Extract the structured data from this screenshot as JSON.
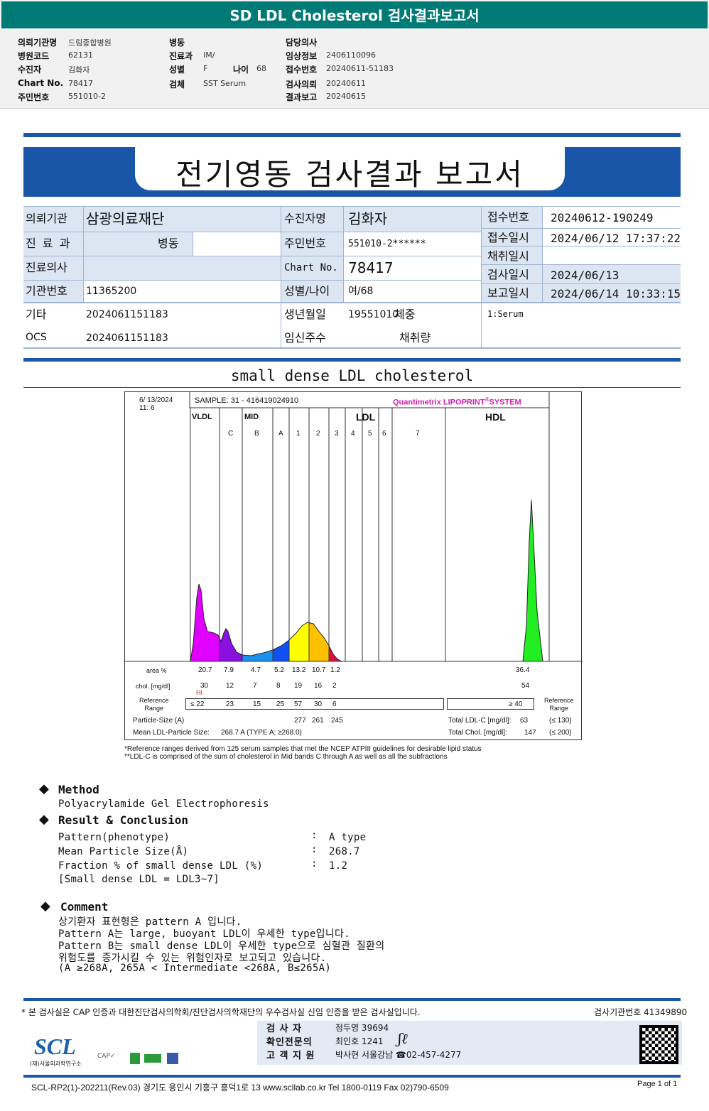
{
  "title": "SD LDL Cholesterol 검사결과보고서",
  "header": {
    "col1": [
      {
        "label": "의뢰기관명",
        "value": "드림종합병원"
      },
      {
        "label": "병원코드",
        "value": "62131"
      },
      {
        "label": "수진자",
        "value": "김화자"
      },
      {
        "label": "Chart No.",
        "value": "78417"
      },
      {
        "label": "주민번호",
        "value": "551010-2"
      }
    ],
    "col2": [
      {
        "label": "병동",
        "value": ""
      },
      {
        "label": "진료과",
        "value": "IM/"
      },
      {
        "label": "성별",
        "value": "F"
      },
      {
        "label": "검체",
        "value": "SST Serum"
      }
    ],
    "age_label": "나이",
    "age_value": "68",
    "col3": [
      {
        "label": "담당의사",
        "value": ""
      },
      {
        "label": "임상정보",
        "value": "2406110096"
      },
      {
        "label": "접수번호",
        "value": "20240611-51183"
      },
      {
        "label": "검사의뢰",
        "value": "20240611"
      },
      {
        "label": "결과보고",
        "value": "20240615"
      }
    ]
  },
  "report_title": "전기영동 검사결과 보고서",
  "info": {
    "inst_label": "의뢰기관",
    "inst": "삼광의료재단",
    "dept_label": "진 료 과",
    "ward_label": "병동",
    "doctor_label": "진료의사",
    "instno_label": "기관번호",
    "instno": "11365200",
    "etc_label": "기타",
    "etc": "2024061151183",
    "ocs_label": "OCS",
    "ocs": "2024061151183",
    "name_label": "수진자명",
    "name": "김화자",
    "ssn_label": "주민번호",
    "ssn": "551010-2******",
    "chart_label": "Chart No.",
    "chart": "78417",
    "sexage_label": "성별/나이",
    "sexage": "여/68",
    "dob_label": "생년월일",
    "dob": "19551010",
    "weight_label": "체중",
    "preg_label": "임신주수",
    "vol_label": "채취량",
    "rcpt_label": "접수번호",
    "rcpt": "20240612-190249",
    "rcpt_time_label": "접수일시",
    "rcpt_time": "2024/06/12 17:37:22",
    "collect_label": "채취일시",
    "collect": "",
    "test_label": "검사일시",
    "test": "2024/06/13",
    "report_label": "보고일시",
    "report": "2024/06/14 10:33:15",
    "specimen": "1:Serum"
  },
  "section_title": "small dense LDL cholesterol",
  "lipoprint": {
    "date": "6/ 13/2024",
    "time": "11:  6",
    "sample": "SAMPLE:    31 - 416419024910",
    "brand": "Quantimetrix LIPOPRINT",
    "brand2": "SYSTEM",
    "groups": [
      "VLDL",
      "MID",
      "LDL",
      "HDL"
    ],
    "bands": [
      "C",
      "B",
      "A",
      "1",
      "2",
      "3",
      "4",
      "5",
      "6",
      "7"
    ],
    "colors": {
      "vldl": "#e000ff",
      "midc": "#8a10e0",
      "midb": "#1a90f0",
      "mida": "#1050f0",
      "ldl1": "#ffff00",
      "ldl2": "#ffc000",
      "ldl3": "#e0103a",
      "hdl": "#22ee22"
    },
    "row_labels": {
      "area": "area %",
      "chol": "chol. [mg/dl]",
      "ref": "Reference\nRange",
      "psize": "Particle-Size (A)",
      "mean": "Mean LDL-Particle Size:"
    },
    "area": [
      "20.7",
      "7.9",
      "4.7",
      "5.2",
      "13.2",
      "10.7",
      "1.2"
    ],
    "area_hdl": "36.4",
    "chol": [
      "30",
      "12",
      "7",
      "8",
      "19",
      "16",
      "2"
    ],
    "chol_hdl": "54",
    "hi_flag": "HI",
    "ref": [
      "≤ 22",
      "23",
      "15",
      "25",
      "57",
      "30",
      "6"
    ],
    "ref_hdl": "≥  40",
    "ref_right": "Reference\nRange",
    "psize": [
      "277",
      "261",
      "245"
    ],
    "mean_value": "268.7  A    (TYPE A; ≥268.0)",
    "total_ldl_label": "Total LDL-C  [mg/dl]:",
    "total_ldl": "63",
    "total_ldl_ref": "(≤ 130)",
    "total_chol_label": "Total Chol.  [mg/dl]:",
    "total_chol": "147",
    "total_chol_ref": "(≤ 200)",
    "note1": "*Reference ranges derived from 125 serum samples that met the NCEP ATPIII guidelines for desirable lipid status",
    "note2": "**LDL-C is comprised of the sum of cholesterol in Mid bands C through A as well as all the subfractions"
  },
  "method": {
    "title": "Method",
    "text": "Polyacrylamide Gel Electrophoresis"
  },
  "result": {
    "title": "Result & Conclusion",
    "rows": [
      {
        "label": "Pattern(phenotype)",
        "value": "A type"
      },
      {
        "label": "Mean Particle Size(Å)",
        "value": "268.7"
      },
      {
        "label": "Fraction % of small dense LDL (%)",
        "value": "1.2"
      }
    ],
    "note": "[Small dense LDL = LDL3~7]"
  },
  "comment": {
    "title": "Comment",
    "lines": [
      "상기환자 표현형은 pattern A 입니다.",
      "Pattern A는 large, buoyant LDL이 우세한 type입니다.",
      "Pattern B는 small dense LDL이 우세한 type으로 심혈관 질환의",
      "위험도를 증가시킬 수 있는 위험인자로 보고되고 있습니다.",
      "(A ≥268A, 265A < Intermediate <268A, B≤265A)"
    ]
  },
  "footer": {
    "cert": "* 본 검사실은 CAP 인증과 대한진단검사의학회/진단검사의학재단의 우수검사실 신임 인증을 받은 검사실입니다.",
    "lab_no": "검사기관번호 41349890",
    "staff": [
      {
        "label": "검   사   자",
        "value": "정두영 39694"
      },
      {
        "label": "확인전문의",
        "value": "최인호 1241"
      },
      {
        "label": "고 객 지 원",
        "value": "박사현 서울강남 ☎02-457-4277"
      }
    ],
    "logo": "SCL",
    "logo_sub": "(재)서울의과학연구소",
    "address": "SCL-RP2(1)-202211(Rev.03)  경기도 용인시 기흥구 흥덕1로 13  www.scllab.co.kr   Tel 1800-0119    Fax 02)790-6509",
    "page": "Page 1 of 1"
  }
}
